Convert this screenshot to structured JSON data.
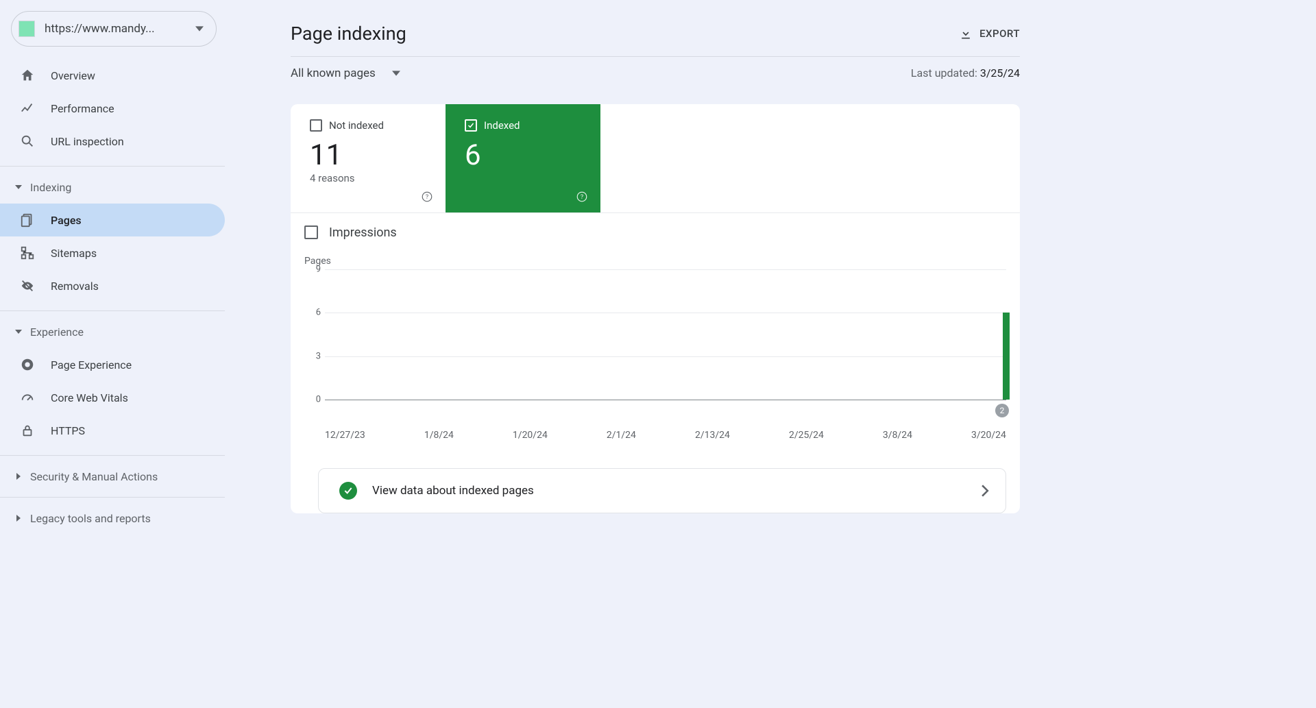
{
  "property": {
    "url": "https://www.mandy..."
  },
  "sidebar": {
    "top": [
      {
        "label": "Overview",
        "icon": "home"
      },
      {
        "label": "Performance",
        "icon": "trend"
      },
      {
        "label": "URL inspection",
        "icon": "search"
      }
    ],
    "sections": [
      {
        "title": "Indexing",
        "expanded": true,
        "items": [
          {
            "label": "Pages",
            "icon": "page",
            "active": true
          },
          {
            "label": "Sitemaps",
            "icon": "sitemap"
          },
          {
            "label": "Removals",
            "icon": "remove"
          }
        ]
      },
      {
        "title": "Experience",
        "expanded": true,
        "items": [
          {
            "label": "Page Experience",
            "icon": "circle"
          },
          {
            "label": "Core Web Vitals",
            "icon": "speed"
          },
          {
            "label": "HTTPS",
            "icon": "lock"
          }
        ]
      },
      {
        "title": "Security & Manual Actions",
        "expanded": false,
        "items": []
      },
      {
        "title": "Legacy tools and reports",
        "expanded": false,
        "items": []
      }
    ]
  },
  "header": {
    "title": "Page indexing",
    "export": "EXPORT",
    "filter": "All known pages",
    "last_updated_label": "Last updated: ",
    "last_updated_date": "3/25/24"
  },
  "stats": {
    "not_indexed": {
      "label": "Not indexed",
      "value": "11",
      "sub": "4 reasons"
    },
    "indexed": {
      "label": "Indexed",
      "value": "6"
    },
    "impressions_label": "Impressions"
  },
  "chart_title": "Pages",
  "chart_badge": "2",
  "view_data": "View data about indexed pages",
  "chart_data": {
    "type": "bar",
    "title": "Pages",
    "ylabel": "Pages",
    "ylim": [
      0,
      9
    ],
    "y_ticks": [
      0,
      3,
      6,
      9
    ],
    "categories": [
      "12/27/23",
      "1/8/24",
      "1/20/24",
      "2/1/24",
      "2/13/24",
      "2/25/24",
      "3/8/24",
      "3/20/24"
    ],
    "series": [
      {
        "name": "Indexed",
        "values": [
          0,
          0,
          0,
          0,
          0,
          0,
          0,
          6
        ],
        "color": "#1e8e3e"
      }
    ]
  }
}
